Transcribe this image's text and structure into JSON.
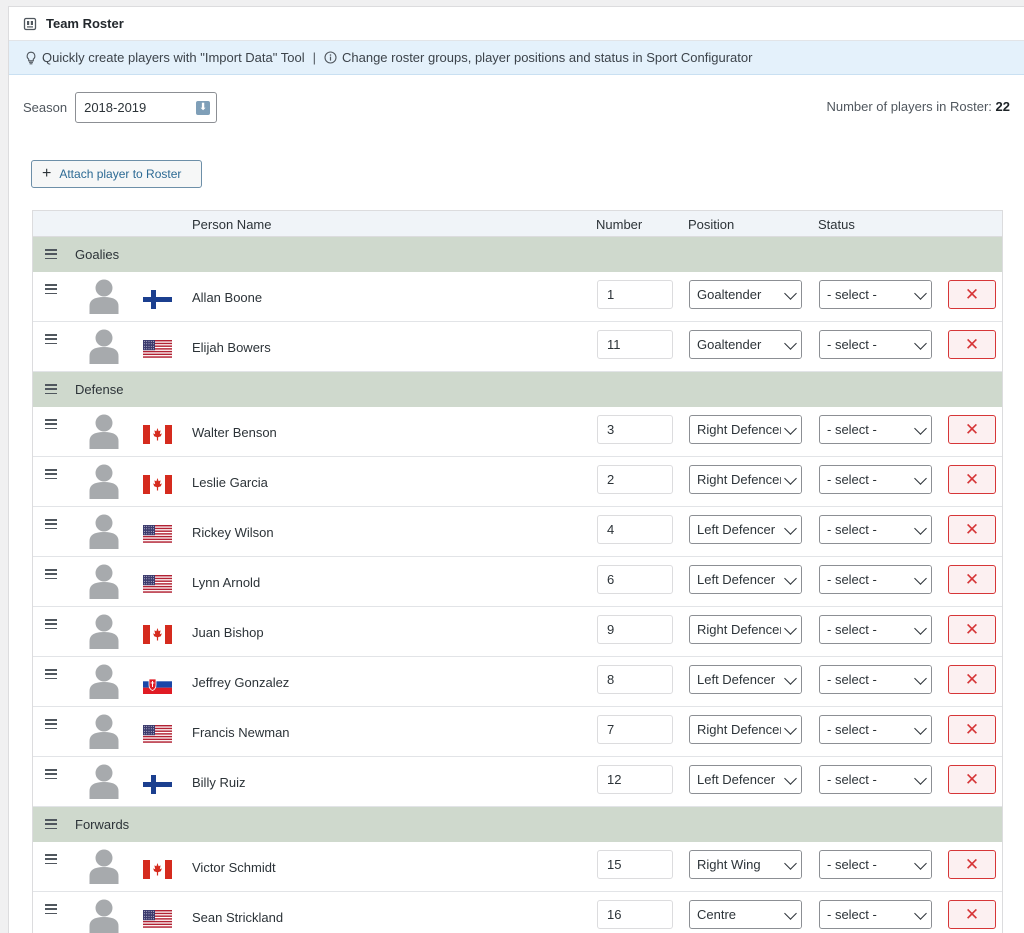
{
  "header": {
    "title": "Team Roster",
    "icon": "roster-icon"
  },
  "notice": {
    "import_text": "Quickly create players with \"Import Data\" Tool",
    "separator": "|",
    "config_text": "Change roster groups, player positions and status in Sport Configurator"
  },
  "season": {
    "label": "Season",
    "value": "2018-2019"
  },
  "roster_count": {
    "label": "Number of players in Roster:",
    "value": "22"
  },
  "attach_button": {
    "plus": "+",
    "label": "Attach player to Roster"
  },
  "columns": {
    "person_name": "Person Name",
    "number": "Number",
    "position": "Position",
    "status": "Status"
  },
  "status_placeholder": "- select -",
  "delete_glyph": "✕",
  "groups": [
    {
      "name": "Goalies",
      "players": [
        {
          "name": "Allan Boone",
          "flag": "finland",
          "number": "1",
          "position": "Goaltender"
        },
        {
          "name": "Elijah Bowers",
          "flag": "usa",
          "number": "11",
          "position": "Goaltender"
        }
      ]
    },
    {
      "name": "Defense",
      "players": [
        {
          "name": "Walter Benson",
          "flag": "canada",
          "number": "3",
          "position": "Right Defencer"
        },
        {
          "name": "Leslie Garcia",
          "flag": "canada",
          "number": "2",
          "position": "Right Defencer"
        },
        {
          "name": "Rickey Wilson",
          "flag": "usa",
          "number": "4",
          "position": "Left Defencer"
        },
        {
          "name": "Lynn Arnold",
          "flag": "usa",
          "number": "6",
          "position": "Left Defencer"
        },
        {
          "name": "Juan Bishop",
          "flag": "canada",
          "number": "9",
          "position": "Right Defencer"
        },
        {
          "name": "Jeffrey Gonzalez",
          "flag": "slovakia",
          "number": "8",
          "position": "Left Defencer"
        },
        {
          "name": "Francis Newman",
          "flag": "usa",
          "number": "7",
          "position": "Right Defencer"
        },
        {
          "name": "Billy Ruiz",
          "flag": "finland",
          "number": "12",
          "position": "Left Defencer"
        }
      ]
    },
    {
      "name": "Forwards",
      "players": [
        {
          "name": "Victor Schmidt",
          "flag": "canada",
          "number": "15",
          "position": "Right Wing"
        },
        {
          "name": "Sean Strickland",
          "flag": "usa",
          "number": "16",
          "position": "Centre"
        }
      ]
    }
  ]
}
